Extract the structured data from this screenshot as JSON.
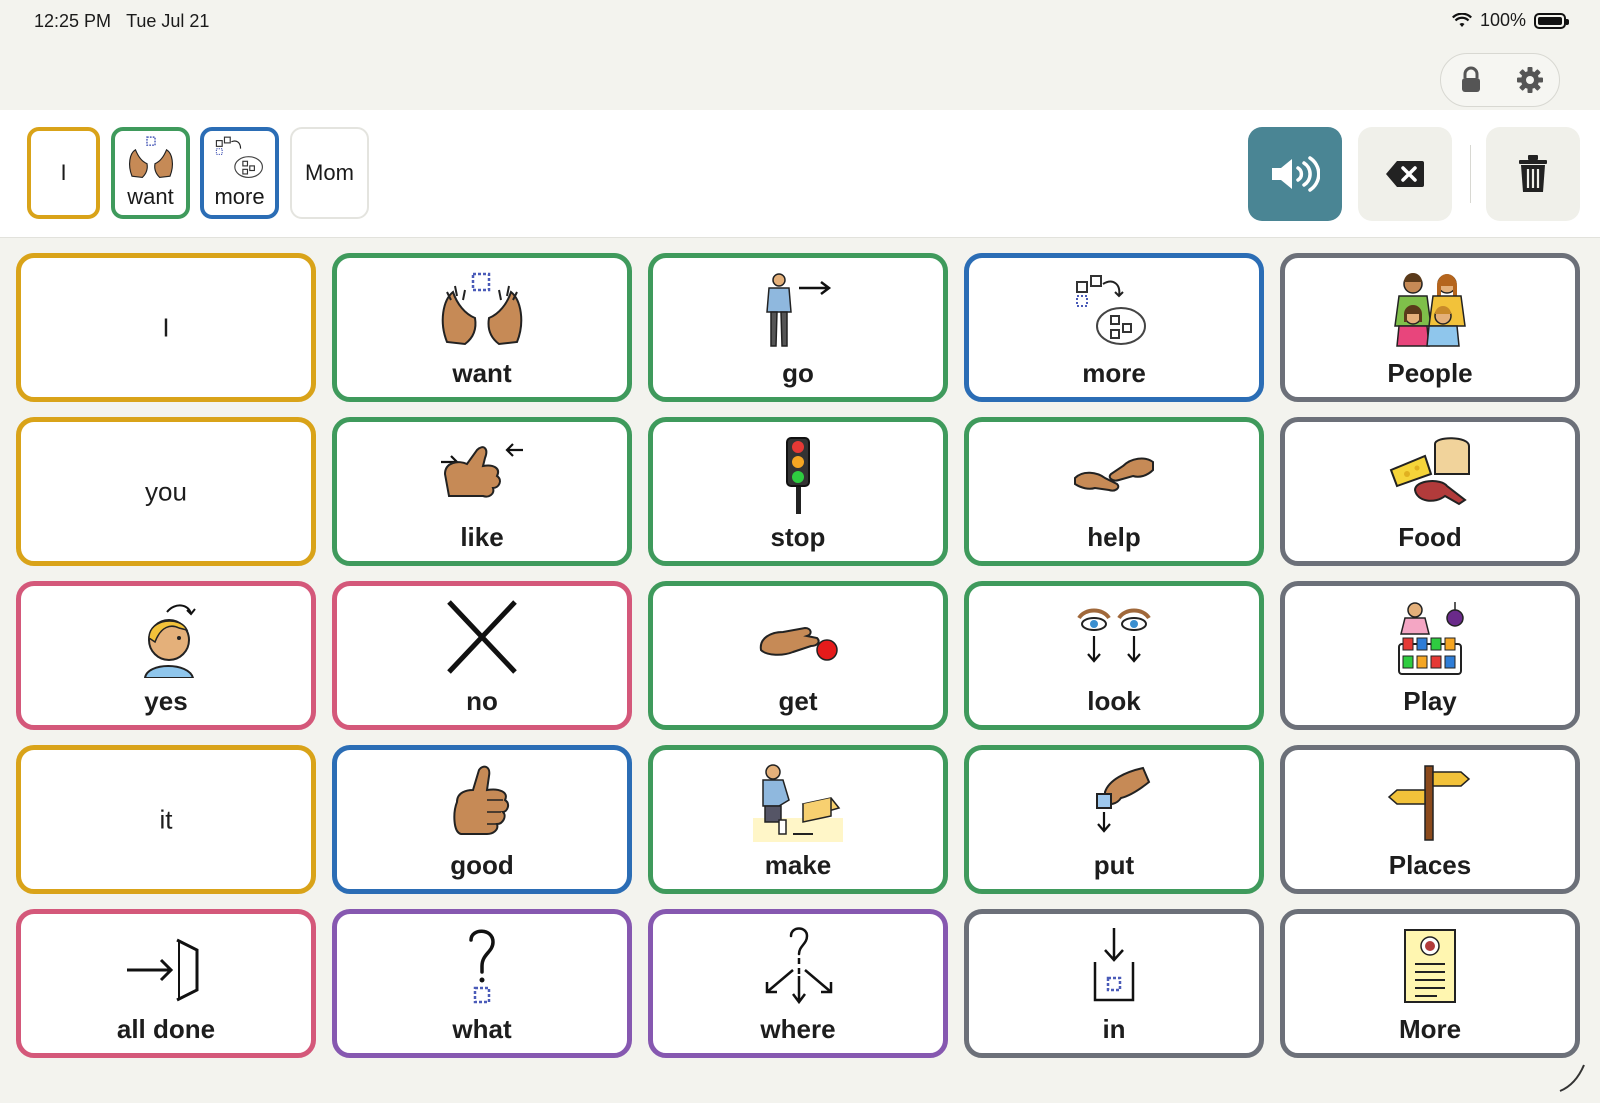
{
  "status": {
    "time": "12:25 PM",
    "date": "Tue Jul 21",
    "battery": "100%"
  },
  "colors": {
    "pronoun": "#d9a319",
    "verb": "#3f9a5c",
    "describe": "#2b6db5",
    "category": "#6c7079",
    "social": "#d4587a",
    "question": "#8658b0",
    "speak_button": "#4a8594"
  },
  "top_tools": [
    {
      "icon": "lock-icon"
    },
    {
      "icon": "gear-icon"
    }
  ],
  "sentence": [
    {
      "label": "I",
      "icon": "none",
      "color": "pronoun"
    },
    {
      "label": "want",
      "icon": "want-hands-icon",
      "color": "verb"
    },
    {
      "label": "more",
      "icon": "more-icon",
      "color": "describe"
    },
    {
      "label": "Mom",
      "icon": "none",
      "color": "none"
    }
  ],
  "actions": {
    "speak": "speaker-icon",
    "backspace": "backspace-icon",
    "clear": "trash-icon"
  },
  "grid": [
    [
      {
        "word": "I",
        "icon": "none"
      },
      {
        "word": "want",
        "icon": "want-hands-icon"
      },
      {
        "word": "go",
        "icon": "go-person-icon"
      },
      {
        "word": "more",
        "icon": "more-icon"
      },
      {
        "word": "People",
        "icon": "people-icon"
      }
    ],
    [
      {
        "word": "you",
        "icon": "none"
      },
      {
        "word": "like",
        "icon": "like-thumb-icon"
      },
      {
        "word": "stop",
        "icon": "traffic-light-icon"
      },
      {
        "word": "help",
        "icon": "help-hands-icon"
      },
      {
        "word": "Food",
        "icon": "food-icon"
      }
    ],
    [
      {
        "word": "yes",
        "icon": "yes-nod-icon"
      },
      {
        "word": "no",
        "icon": "no-cross-icon"
      },
      {
        "word": "get",
        "icon": "get-hand-icon"
      },
      {
        "word": "look",
        "icon": "look-eyes-icon"
      },
      {
        "word": "Play",
        "icon": "play-toys-icon"
      }
    ],
    [
      {
        "word": "it",
        "icon": "none"
      },
      {
        "word": "good",
        "icon": "thumbs-up-icon"
      },
      {
        "word": "make",
        "icon": "make-person-icon"
      },
      {
        "word": "put",
        "icon": "put-hand-icon"
      },
      {
        "word": "Places",
        "icon": "signpost-icon"
      }
    ],
    [
      {
        "word": "all done",
        "icon": "exit-arrow-icon"
      },
      {
        "word": "what",
        "icon": "question-icon"
      },
      {
        "word": "where",
        "icon": "where-arrows-icon"
      },
      {
        "word": "in",
        "icon": "in-arrow-icon"
      },
      {
        "word": "More",
        "icon": "more-page-icon"
      }
    ]
  ]
}
